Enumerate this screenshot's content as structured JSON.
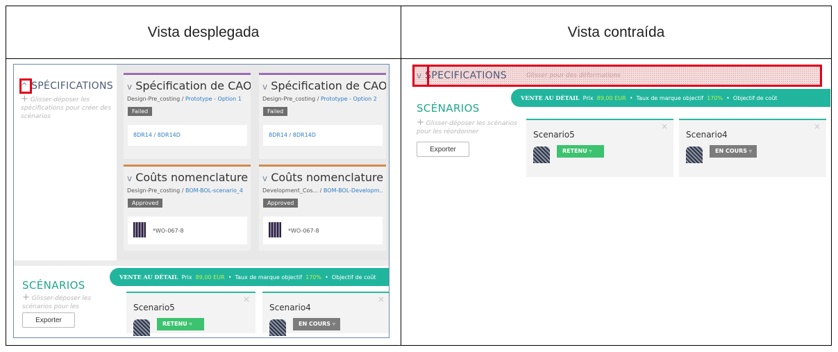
{
  "headers": {
    "expanded": "Vista desplegada",
    "collapsed": "Vista contraída"
  },
  "specs": {
    "title": "SPÉCIFICATIONS",
    "title_collapsed": "SPECIFICATIONS",
    "chevron_up": "^",
    "chevron_down": "v",
    "hint": "Glisser-déposer les spécifications pour créer des scénarios",
    "hint_collapsed": "Glisser pour des déformations",
    "cards": [
      {
        "title": "Spécification de CAO",
        "sub_a": "Design-Pre_costing / ",
        "sub_b": "Prototype",
        "sub_c": " - Option 1",
        "status": "Failed",
        "box": "8DR14 / 8DR14D"
      },
      {
        "title": "Spécification de CAO",
        "sub_a": "Design-Pre_costing / ",
        "sub_b": "Prototype",
        "sub_c": " - Option 2",
        "status": "Failed",
        "box": "8DR14 / 8DR14D"
      },
      {
        "title": "Coûts nomenclature ...",
        "sub_a": "Design-Pre_costing / ",
        "sub_b": "BOM-BOL-scenario_4",
        "sub_c": "",
        "status": "Approved",
        "box": "*WO-067-8"
      },
      {
        "title": "Coûts nomenclature ...",
        "sub_a": "Development_Cos... / ",
        "sub_b": "BOM-BOL-Developm..",
        "sub_c": "",
        "status": "Approved",
        "box": "*WO-067-8"
      }
    ]
  },
  "scenarios": {
    "title": "SCÉNARIOS",
    "hint": "Glisser-déposer les scénarios pour les réordonner",
    "export": "Exporter",
    "ribbon": {
      "lead": "VENTE AU DÉTAIL",
      "price_label": "Prix",
      "price": "89,00 EUR",
      "sep": "•",
      "markup_label": "Taux de marque objectif",
      "markup": "170%",
      "target_label": "Objectif de coût"
    },
    "cards": [
      {
        "name": "Scenario5",
        "status": "RETENU",
        "close": "×"
      },
      {
        "name": "Scenario4",
        "status": "EN COURS",
        "close": "×"
      }
    ]
  },
  "colors": {
    "annotation": "#e0001b",
    "teal": "#22b59e",
    "retenu": "#3dc26f",
    "en_cours": "#7c7c7c"
  }
}
